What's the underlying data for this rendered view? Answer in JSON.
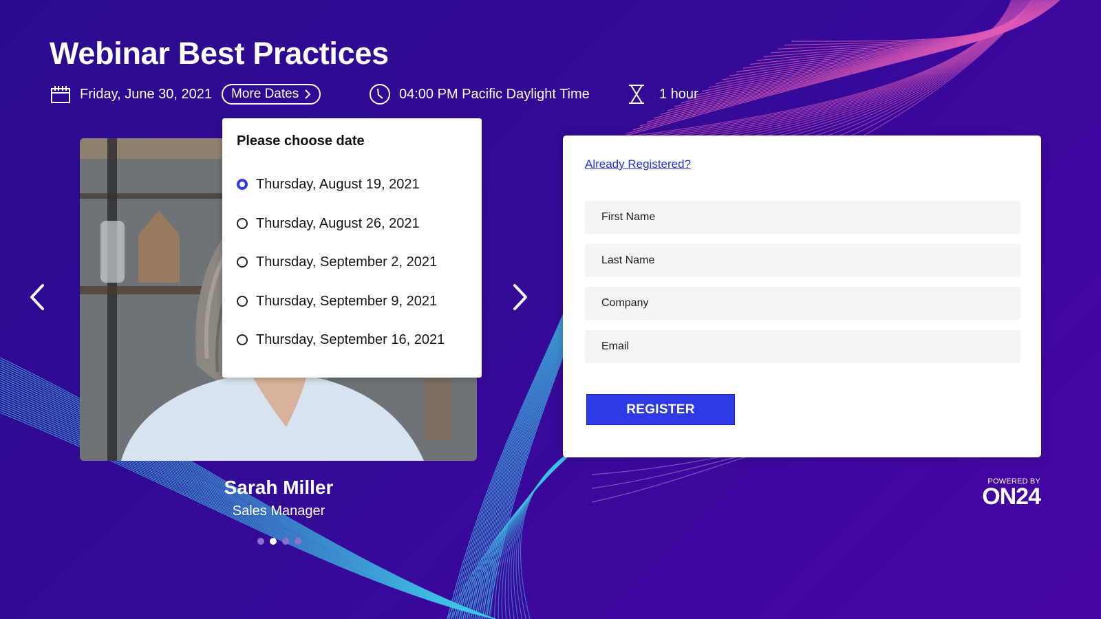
{
  "page": {
    "title": "Webinar Best Practices"
  },
  "event": {
    "date": "Friday, June 30, 2021",
    "more_dates_label": "More Dates",
    "time": "04:00 PM Pacific Daylight Time",
    "duration": "1 hour",
    "icons": {
      "date": "calendar-icon",
      "more_dates": "chevron-right-icon",
      "time": "clock-icon",
      "duration": "hourglass-icon"
    }
  },
  "date_picker": {
    "heading": "Please choose date",
    "selected_index": 0,
    "options": [
      {
        "label": "Thursday, August 19, 2021",
        "checked": true
      },
      {
        "label": "Thursday, August 26, 2021",
        "checked": false
      },
      {
        "label": "Thursday, September 2, 2021",
        "checked": false
      },
      {
        "label": "Thursday, September 9, 2021",
        "checked": false
      },
      {
        "label": "Thursday, September 16, 2021",
        "checked": false
      }
    ]
  },
  "speaker_carousel": {
    "name": "Sarah Miller",
    "role": "Sales Manager",
    "prev_icon": "chevron-left-icon",
    "next_icon": "chevron-right-icon",
    "slide_count": 4,
    "active_slide": 2
  },
  "registration": {
    "already_registered_label": "Already Registered?",
    "fields": [
      {
        "name": "first-name",
        "placeholder": "First Name",
        "value": ""
      },
      {
        "name": "last-name",
        "placeholder": "Last Name",
        "value": ""
      },
      {
        "name": "company",
        "placeholder": "Company",
        "value": ""
      },
      {
        "name": "email",
        "placeholder": "Email",
        "value": ""
      }
    ],
    "submit_label": "REGISTER"
  },
  "footer": {
    "powered_by": "POWERED BY",
    "brand": "ON24"
  },
  "colors": {
    "background_start": "#2a0b8e",
    "background_end": "#4806a2",
    "accent_blue": "#2e3ae3",
    "link_blue": "#2b2fd6",
    "wave_pink": "#e05bb5",
    "wave_cyan": "#3fc6e6"
  }
}
